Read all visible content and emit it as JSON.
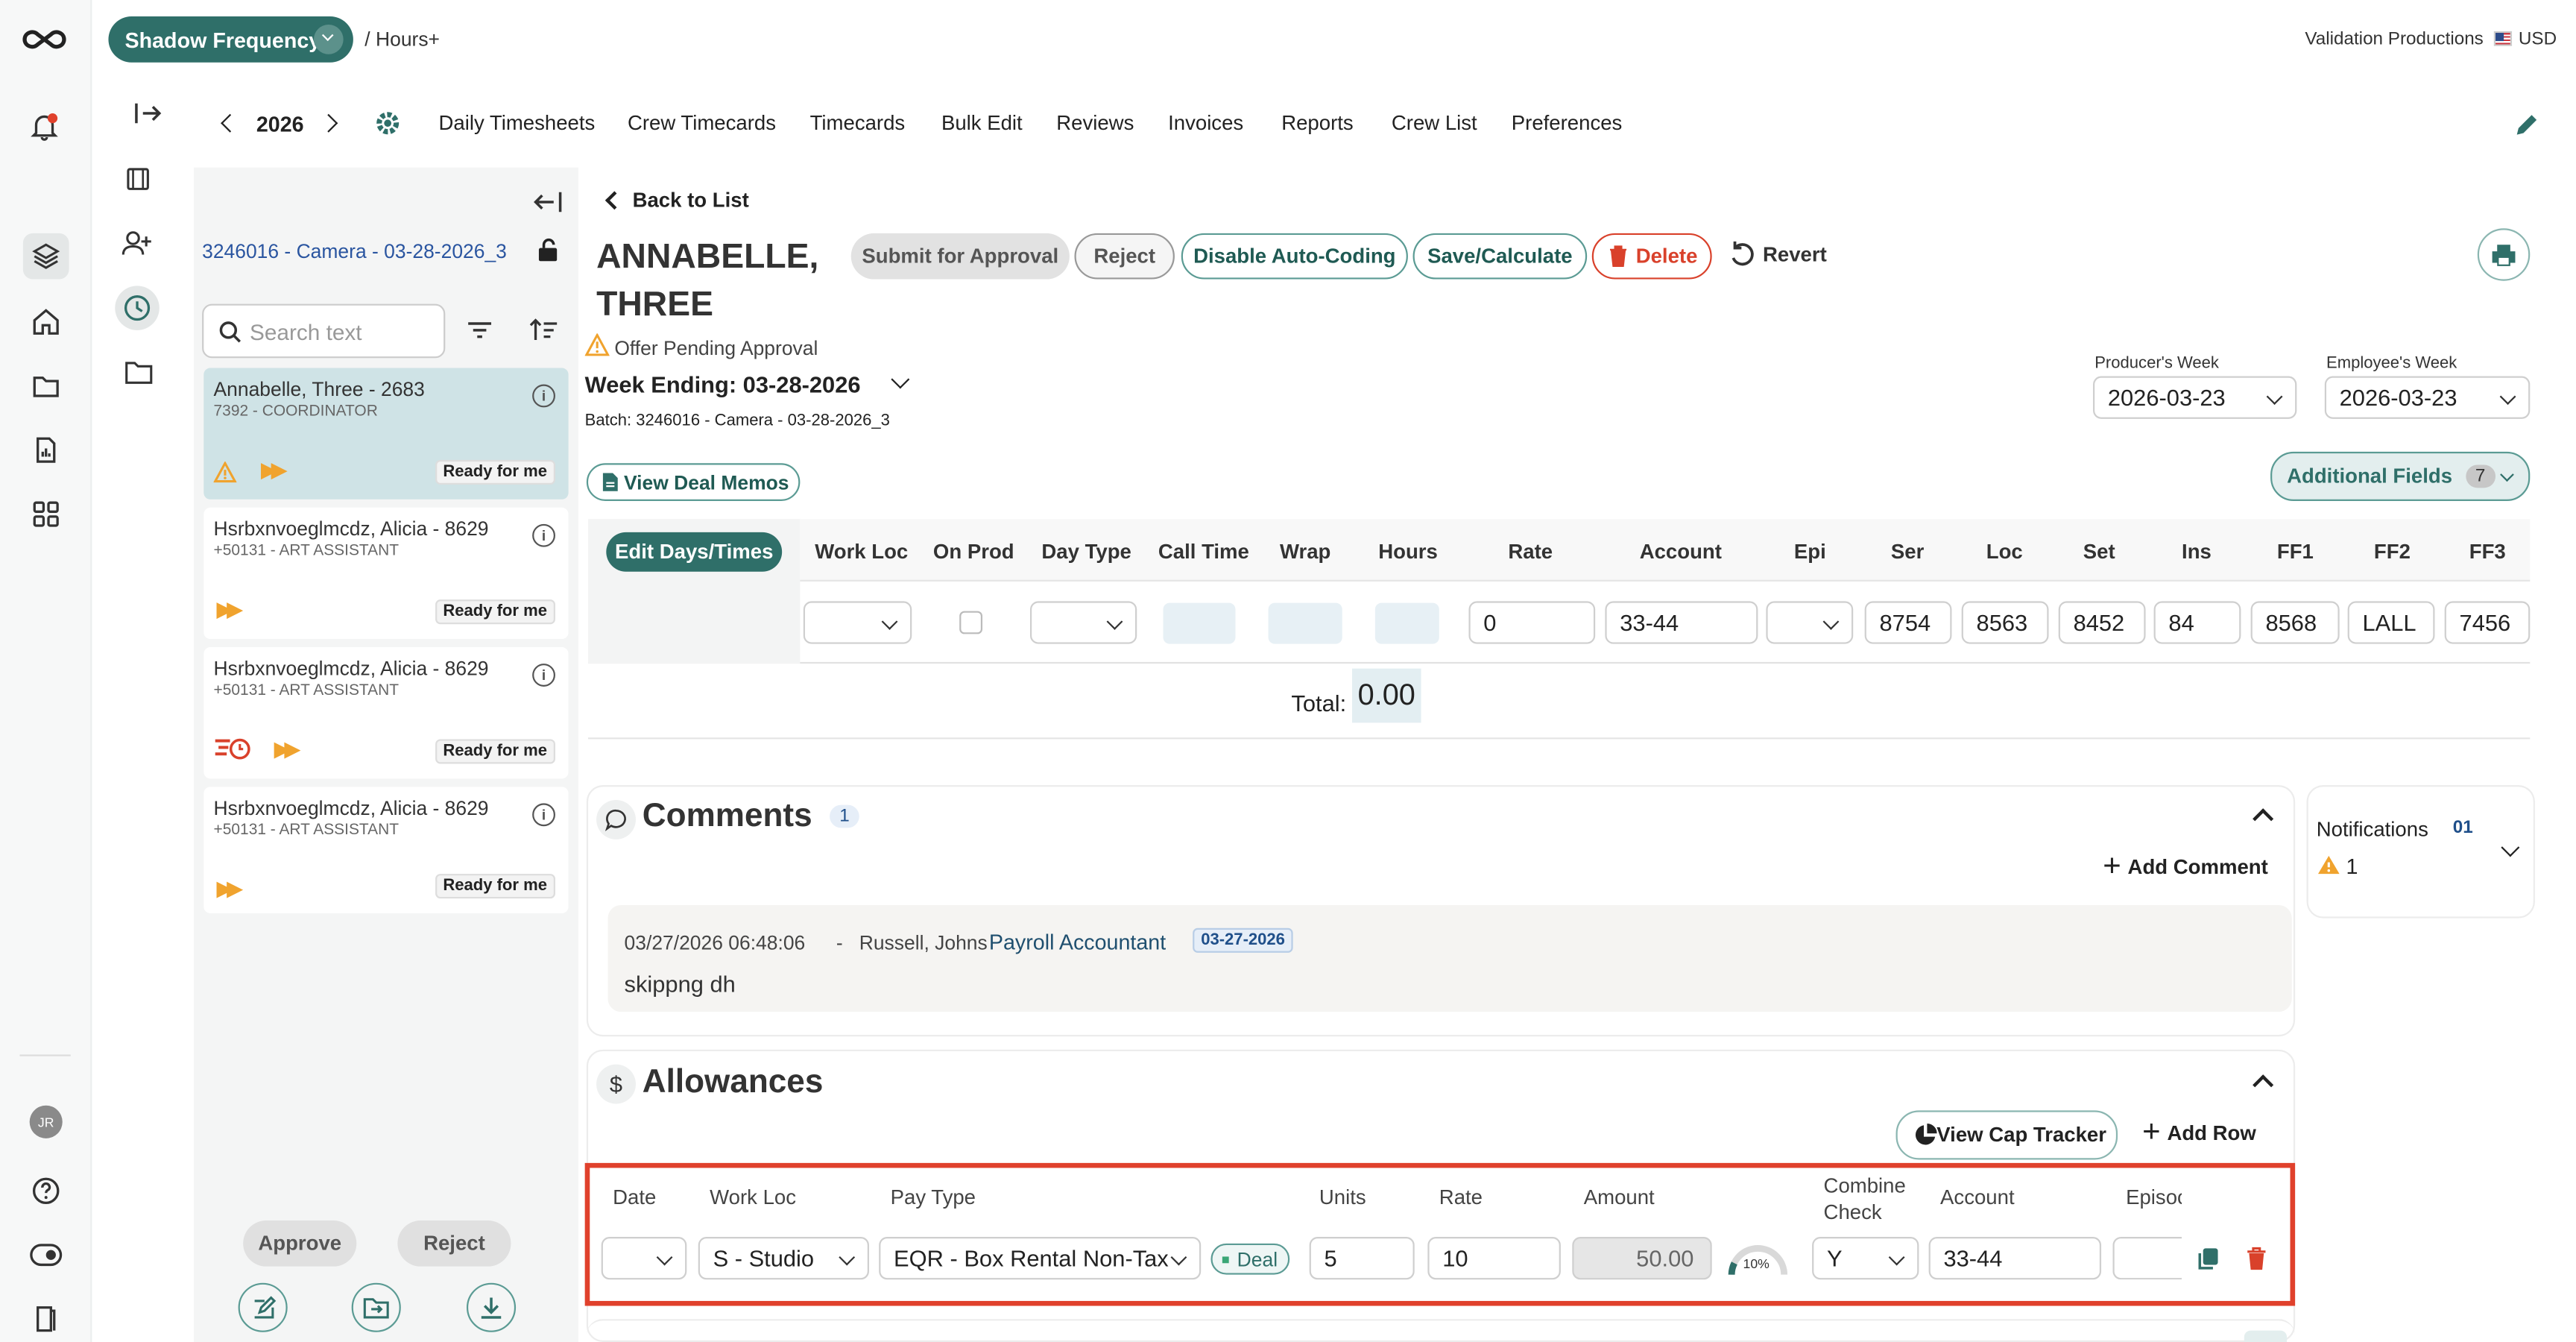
{
  "header": {
    "project": "Shadow Frequency",
    "breadcrumb": "/ Hours+",
    "company": "Validation Productions",
    "currency": "USD"
  },
  "toolbar": {
    "year": "2026",
    "nav": [
      "Daily Timesheets",
      "Crew Timecards",
      "Timecards",
      "Bulk Edit",
      "Reviews",
      "Invoices",
      "Reports",
      "Crew List",
      "Preferences"
    ]
  },
  "sidebar": {
    "batch": "3246016 - Camera - 03-28-2026_3",
    "search_placeholder": "Search text",
    "cards": [
      {
        "name": "Annabelle, Three - 2683",
        "role": "7392 - COORDINATOR",
        "badge": "Ready for me"
      },
      {
        "name": "Hsrbxnvoeglmcdz, Alicia - 8629",
        "role": "+50131 - ART ASSISTANT",
        "badge": "Ready for me"
      },
      {
        "name": "Hsrbxnvoeglmcdz, Alicia - 8629",
        "role": "+50131 - ART ASSISTANT",
        "badge": "Ready for me"
      },
      {
        "name": "Hsrbxnvoeglmcdz, Alicia - 8629",
        "role": "+50131 - ART ASSISTANT",
        "badge": "Ready for me"
      }
    ],
    "approve": "Approve",
    "reject": "Reject",
    "user_initials": "JR"
  },
  "main": {
    "back": "Back to List",
    "name_line1": "ANNABELLE,",
    "name_line2": "THREE",
    "actions": {
      "submit": "Submit for Approval",
      "reject": "Reject",
      "disable": "Disable Auto-Coding",
      "save": "Save/Calculate",
      "delete": "Delete",
      "revert": "Revert"
    },
    "offer_status": "Offer Pending Approval",
    "week_ending": "Week Ending: 03-28-2026",
    "batch": "Batch: 3246016 - Camera - 03-28-2026_3",
    "view_deal_memos": "View Deal Memos",
    "producers_week_label": "Producer's Week",
    "producers_week": "2026-03-23",
    "employees_week_label": "Employee's Week",
    "employees_week": "2026-03-23",
    "additional_fields": "Additional Fields",
    "additional_fields_count": "7",
    "grid_headers": {
      "edit": "Edit Days/Times",
      "work_loc": "Work Loc",
      "on_prod": "On Prod",
      "day_type": "Day Type",
      "call_time": "Call Time",
      "wrap": "Wrap",
      "hours": "Hours",
      "rate": "Rate",
      "account": "Account",
      "epi": "Epi",
      "ser": "Ser",
      "loc": "Loc",
      "set": "Set",
      "ins": "Ins",
      "ff1": "FF1",
      "ff2": "FF2",
      "ff3": "FF3"
    },
    "grid_row": {
      "rate": "0",
      "account": "33-44",
      "ser": "8754",
      "loc": "8563",
      "set": "8452",
      "ins": "84",
      "ff1": "8568",
      "ff2": "LALL",
      "ff3": "7456"
    },
    "total_label": "Total:",
    "total_value": "0.00"
  },
  "comments": {
    "title": "Comments",
    "count": "1",
    "add": "Add Comment",
    "timestamp": "03/27/2026 06:48:06",
    "author": "Russell, Johns",
    "role": "Payroll Accountant",
    "date_tag": "03-27-2026",
    "text": "skippng dh",
    "separator": "-"
  },
  "notifications": {
    "title": "Notifications",
    "count": "01",
    "warnings": "1"
  },
  "allowances": {
    "title": "Allowances",
    "view_cap": "View Cap Tracker",
    "add_row": "Add Row",
    "headers": {
      "date": "Date",
      "work_loc": "Work Loc",
      "pay_type": "Pay Type",
      "units": "Units",
      "rate": "Rate",
      "amount": "Amount",
      "combine1": "Combine",
      "combine2": "Check",
      "account": "Account",
      "episode": "Episoc"
    },
    "row": {
      "work_loc": "S - Studio",
      "pay_type": "EQR - Box Rental Non-Tax",
      "deal": "Deal",
      "units": "5",
      "rate": "10",
      "amount": "50.00",
      "percent": "10%",
      "combine": "Y",
      "account": "33-44"
    }
  },
  "colors": {
    "teal": "#2f6f69",
    "accent_teal": "#5b9b94",
    "highlight_red": "#e0412c",
    "warning": "#f0a32e",
    "delete_red": "#d9412b"
  }
}
